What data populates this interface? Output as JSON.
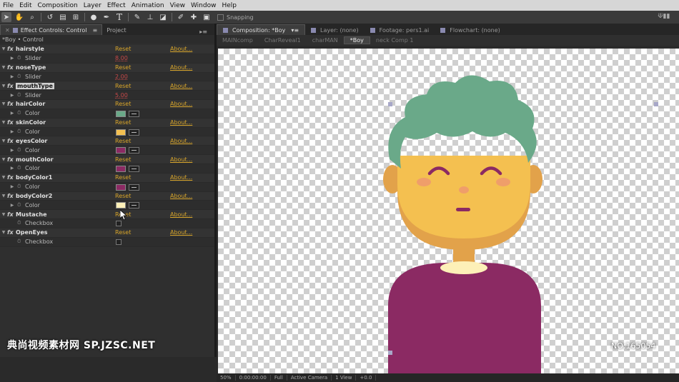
{
  "menu": [
    "File",
    "Edit",
    "Composition",
    "Layer",
    "Effect",
    "Animation",
    "View",
    "Window",
    "Help"
  ],
  "toolbar": {
    "snapping_label": "Snapping",
    "icons": [
      "select-icon",
      "hand-icon",
      "zoom-icon",
      "rotate-icon",
      "camera-icon",
      "pan-behind-icon",
      "mask-ellipse-icon",
      "pen-icon",
      "text-icon",
      "brush-icon",
      "clone-stamp-icon",
      "eraser-icon",
      "roto-brush-icon",
      "puppet-pin-icon"
    ]
  },
  "left_panel": {
    "tab_active": "Effect Controls: Control",
    "tab_other": "Project",
    "header": "*Boy • Control",
    "effects": [
      {
        "name": "hairstyle",
        "reset": "Reset",
        "about": "About...",
        "param": "Slider",
        "kind": "slider",
        "value": "8.00"
      },
      {
        "name": "noseType",
        "reset": "Reset",
        "about": "About...",
        "param": "Slider",
        "kind": "slider",
        "value": "2.00"
      },
      {
        "name": "mouthType",
        "reset": "Reset",
        "about": "About...",
        "param": "Slider",
        "kind": "slider",
        "value": "5.00",
        "selected": true
      },
      {
        "name": "hairColor",
        "reset": "Reset",
        "about": "About...",
        "param": "Color",
        "kind": "color",
        "color": "#6aa989"
      },
      {
        "name": "skinColor",
        "reset": "Reset",
        "about": "About...",
        "param": "Color",
        "kind": "color",
        "color": "#f4c050"
      },
      {
        "name": "eyesColor",
        "reset": "Reset",
        "about": "About...",
        "param": "Color",
        "kind": "color",
        "color": "#8b2a63"
      },
      {
        "name": "mouthColor",
        "reset": "Reset",
        "about": "About...",
        "param": "Color",
        "kind": "color",
        "color": "#8b2a63"
      },
      {
        "name": "bodyColor1",
        "reset": "Reset",
        "about": "About...",
        "param": "Color",
        "kind": "color",
        "color": "#8b2a63"
      },
      {
        "name": "bodyColor2",
        "reset": "Reset",
        "about": "About...",
        "param": "Color",
        "kind": "color",
        "color": "#fdf0b8"
      },
      {
        "name": "Mustache",
        "reset": "Reset",
        "about": "About...",
        "param": "Checkbox",
        "kind": "checkbox"
      },
      {
        "name": "OpenEyes",
        "reset": "Reset",
        "about": "About...",
        "param": "Checkbox",
        "kind": "checkbox"
      }
    ]
  },
  "comp_panel": {
    "tabs": [
      {
        "label": "Composition: *Boy",
        "active": true
      },
      {
        "label": "Layer: (none)",
        "active": false
      },
      {
        "label": "Footage: pers1.ai",
        "active": false
      },
      {
        "label": "Flowchart: (none)",
        "active": false
      }
    ],
    "breadcrumbs": [
      "MAINcomp",
      "CharReveal1",
      "charMAN",
      "*Boy",
      "neck Comp 1"
    ],
    "active_crumb": "*Boy",
    "footer": [
      "50%",
      "0:00:00:00",
      "Full",
      "Active Camera",
      "1 View",
      "+0.0"
    ]
  },
  "character_colors": {
    "hair": "#6aa989",
    "skin": "#f4c050",
    "skin_shadow": "#e2a24a",
    "cheek": "#ef9e6a",
    "features": "#8b2a63",
    "shirt": "#8b2a63",
    "collar": "#fdf0b8"
  },
  "watermark": {
    "left": "典尚视频素材网 SP.JZSC.NET",
    "right": "NO:165054"
  }
}
